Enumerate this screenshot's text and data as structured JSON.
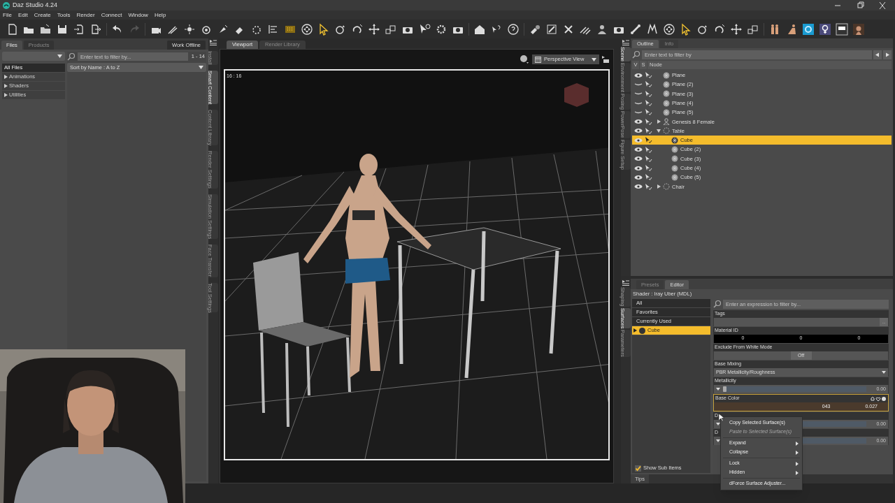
{
  "window": {
    "title": "Daz Studio 4.24"
  },
  "menu": [
    "File",
    "Edit",
    "Create",
    "Tools",
    "Render",
    "Connect",
    "Window",
    "Help"
  ],
  "left_panel": {
    "tabs": [
      {
        "label": "Files",
        "selected": true
      },
      {
        "label": "Products",
        "selected": false
      }
    ],
    "work_offline": "Work Offline",
    "categories": [
      {
        "label": "All Files",
        "selected": true,
        "expandable": false
      },
      {
        "label": "Animations",
        "selected": false,
        "expandable": true
      },
      {
        "label": "Shaders",
        "selected": false,
        "expandable": true
      },
      {
        "label": "Utilities",
        "selected": false,
        "expandable": true
      }
    ],
    "filter": {
      "placeholder": "Enter text to filter by..."
    },
    "count": "1 - 14",
    "sort": "Sort by Name : A to Z"
  },
  "left_side_tabs": [
    {
      "label": "Install",
      "selected": false
    },
    {
      "label": "Smart Content",
      "selected": true
    },
    {
      "label": "Content Library",
      "selected": false
    },
    {
      "label": "Render Settings",
      "selected": false
    },
    {
      "label": "Simulation Settings",
      "selected": false
    },
    {
      "label": "Face Transfer",
      "selected": false
    },
    {
      "label": "Tool Settings",
      "selected": false
    }
  ],
  "viewport": {
    "tabs": [
      {
        "label": "Viewport",
        "selected": true
      },
      {
        "label": "Render Library",
        "selected": false
      }
    ],
    "view": "Perspective View",
    "aspect": "16 : 16"
  },
  "right_side_tabs": [
    {
      "label": "Scene",
      "selected": true
    },
    {
      "label": "Environment",
      "selected": false
    },
    {
      "label": "Posing",
      "selected": false
    },
    {
      "label": "PowerPose",
      "selected": false
    },
    {
      "label": "Figure Setup",
      "selected": false
    }
  ],
  "scene": {
    "tabs": [
      {
        "label": "Outline",
        "selected": true
      },
      {
        "label": "Info",
        "selected": false
      }
    ],
    "filter": {
      "placeholder": "Enter text to filter by"
    },
    "columns": [
      "V",
      "S",
      "Node"
    ],
    "nodes": [
      {
        "label": "Plane",
        "kind": "mesh",
        "visible": true,
        "selected": false
      },
      {
        "label": "Plane (2)",
        "kind": "mesh",
        "visible": false,
        "selected": false
      },
      {
        "label": "Plane (3)",
        "kind": "mesh",
        "visible": false,
        "selected": false
      },
      {
        "label": "Plane (4)",
        "kind": "mesh",
        "visible": false,
        "selected": false
      },
      {
        "label": "Plane (5)",
        "kind": "mesh",
        "visible": false,
        "selected": false
      },
      {
        "label": "Genesis 8 Female",
        "kind": "figure",
        "visible": true,
        "selected": false,
        "expanded": false
      },
      {
        "label": "Table",
        "kind": "group",
        "visible": true,
        "selected": false,
        "expanded": true,
        "children": [
          {
            "label": "Cube",
            "kind": "mesh",
            "visible": true,
            "selected": true
          },
          {
            "label": "Cube (2)",
            "kind": "mesh",
            "visible": true,
            "selected": false
          },
          {
            "label": "Cube (3)",
            "kind": "mesh",
            "visible": true,
            "selected": false
          },
          {
            "label": "Cube (4)",
            "kind": "mesh",
            "visible": true,
            "selected": false
          },
          {
            "label": "Cube (5)",
            "kind": "mesh",
            "visible": true,
            "selected": false
          }
        ]
      },
      {
        "label": "Chair",
        "kind": "group",
        "visible": true,
        "selected": false,
        "expanded": false
      }
    ]
  },
  "lower_side_tabs": [
    {
      "label": "Shaping",
      "selected": false
    },
    {
      "label": "Surfaces",
      "selected": true
    },
    {
      "label": "Parameters",
      "selected": false
    }
  ],
  "surfaces": {
    "tabs": [
      {
        "label": "Presets",
        "selected": false
      },
      {
        "label": "Editor",
        "selected": true
      }
    ],
    "shader": "Shader : Iray Uber (MDL)",
    "groups": [
      {
        "label": "All",
        "selected": false
      },
      {
        "label": "Favorites",
        "selected": false
      },
      {
        "label": "Currently Used",
        "selected": false
      },
      {
        "label": "Cube",
        "selected": true
      }
    ],
    "show_sub_items": {
      "label": "Show Sub Items",
      "checked": true
    },
    "filter": {
      "placeholder": "Enter an expression to filter by..."
    },
    "properties": [
      {
        "kind": "text",
        "label": "Tags",
        "button": "..."
      },
      {
        "kind": "triple",
        "label": "Material ID",
        "values": [
          "0",
          "0",
          "0"
        ]
      },
      {
        "kind": "toggle",
        "label": "Exclude From White Mode",
        "value": "Off",
        "on": false
      },
      {
        "kind": "select",
        "label": "Base Mixing",
        "value": "PBR Metallicity/Roughness"
      },
      {
        "kind": "slider",
        "label": "Metallicity",
        "level": 0,
        "reading": "0.00"
      },
      {
        "kind": "color",
        "label": "Base Color",
        "values": [
          "043",
          "0.027"
        ]
      },
      {
        "kind": "slider",
        "label": "D",
        "level": 0,
        "reading": "0.00"
      },
      {
        "kind": "slider",
        "label": "D",
        "level": 0,
        "reading": "0.00"
      }
    ],
    "tips": "Tips"
  },
  "context_menu": [
    {
      "label": "Copy Selected Surface(s)",
      "disabled": false,
      "submenu": false
    },
    {
      "label": "Paste to Selected Surface(s)",
      "disabled": true,
      "submenu": false
    },
    {
      "kind": "separator"
    },
    {
      "label": "Expand",
      "disabled": false,
      "submenu": true
    },
    {
      "label": "Collapse",
      "disabled": false,
      "submenu": true
    },
    {
      "kind": "separator"
    },
    {
      "label": "Lock",
      "disabled": false,
      "submenu": true
    },
    {
      "label": "Hidden",
      "disabled": false,
      "submenu": true
    },
    {
      "kind": "separator"
    },
    {
      "label": "dForce Surface Adjuster...",
      "disabled": false,
      "submenu": false
    }
  ]
}
